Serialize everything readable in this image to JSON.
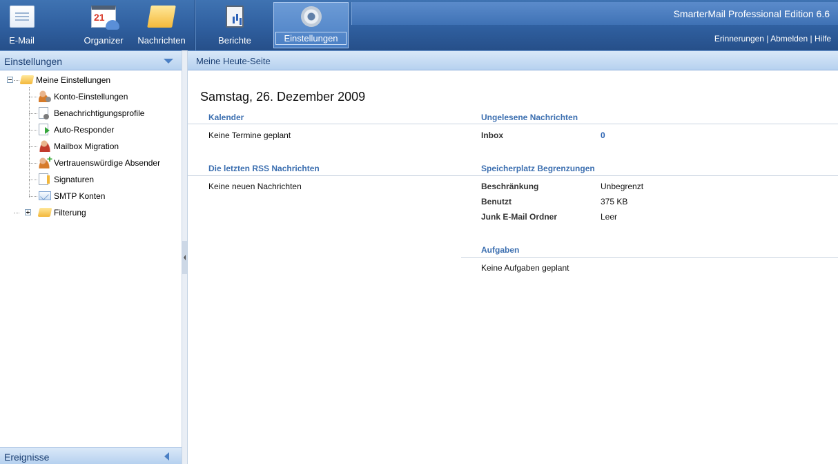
{
  "app": {
    "title": "SmarterMail Professional Edition 6.6",
    "links": [
      "Erinnerungen",
      "Abmelden",
      "Hilfe"
    ],
    "link_separator": "|"
  },
  "toolbar": {
    "buttons": [
      {
        "label": "E-Mail",
        "icon": "mail-icon"
      },
      {
        "label": "Organizer",
        "icon": "calendar-icon"
      },
      {
        "label": "Nachrichten",
        "icon": "folder-icon"
      },
      {
        "label": "Berichte",
        "icon": "report-icon"
      },
      {
        "label": "Einstellungen",
        "icon": "gear-icon",
        "active": true
      }
    ]
  },
  "sidebar": {
    "title": "Einstellungen",
    "tree": {
      "root": {
        "label": "Meine Einstellungen",
        "expanded": true
      },
      "items": [
        {
          "label": "Konto-Einstellungen",
          "icon": "user-settings-icon"
        },
        {
          "label": "Benachrichtigungsprofile",
          "icon": "notification-profile-icon"
        },
        {
          "label": "Auto-Responder",
          "icon": "auto-responder-icon"
        },
        {
          "label": "Mailbox Migration",
          "icon": "mailbox-migration-icon"
        },
        {
          "label": "Vertrauenswürdige Absender",
          "icon": "trusted-sender-icon"
        },
        {
          "label": "Signaturen",
          "icon": "signature-icon"
        },
        {
          "label": "SMTP Konten",
          "icon": "smtp-icon"
        }
      ],
      "filter": {
        "label": "Filterung",
        "expanded": false
      }
    },
    "events_title": "Ereignisse"
  },
  "main": {
    "header": "Meine Heute-Seite",
    "date": "Samstag, 26. Dezember 2009",
    "calendar": {
      "title": "Kalender",
      "text": "Keine Termine geplant"
    },
    "rss": {
      "title": "Die letzten RSS Nachrichten",
      "text": "Keine neuen Nachrichten"
    },
    "unread": {
      "title": "Ungelesene Nachrichten",
      "rows": [
        {
          "label": "Inbox",
          "value": "0"
        }
      ]
    },
    "storage": {
      "title": "Speicherplatz Begrenzungen",
      "rows": [
        {
          "label": "Beschränkung",
          "value": "Unbegrenzt"
        },
        {
          "label": "Benutzt",
          "value": "375 KB"
        },
        {
          "label": "Junk E-Mail Ordner",
          "value": "Leer"
        }
      ]
    },
    "tasks": {
      "title": "Aufgaben",
      "text": "Keine Aufgaben geplant"
    }
  },
  "colors": {
    "accent": "#3c6fb0",
    "toolbar": "#2f5f9f",
    "link": "#2b63b2"
  }
}
